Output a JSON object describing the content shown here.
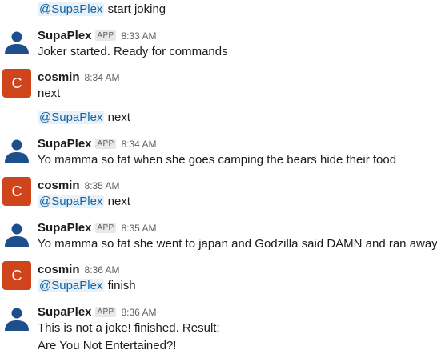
{
  "messages": [
    {
      "id": "m0",
      "continuation": true,
      "lines": [
        {
          "mention": "@SupaPlex",
          "text": " start joking"
        }
      ]
    },
    {
      "id": "m1",
      "author": "SupaPlex",
      "bot": true,
      "badge": "APP",
      "time": "8:33 AM",
      "lines": [
        {
          "text": "Joker started. Ready for commands"
        }
      ]
    },
    {
      "id": "m2",
      "author": "cosmin",
      "bot": false,
      "initial": "C",
      "time": "8:34 AM",
      "lines": [
        {
          "text": "next"
        }
      ]
    },
    {
      "id": "m3",
      "continuation": true,
      "lines": [
        {
          "mention": "@SupaPlex",
          "text": " next"
        }
      ]
    },
    {
      "id": "m4",
      "author": "SupaPlex",
      "bot": true,
      "badge": "APP",
      "time": "8:34 AM",
      "lines": [
        {
          "text": "Yo mamma so fat when she goes camping the bears hide their food"
        }
      ]
    },
    {
      "id": "m5",
      "author": "cosmin",
      "bot": false,
      "initial": "C",
      "time": "8:35 AM",
      "lines": [
        {
          "mention": "@SupaPlex",
          "text": " next"
        }
      ]
    },
    {
      "id": "m6",
      "author": "SupaPlex",
      "bot": true,
      "badge": "APP",
      "time": "8:35 AM",
      "lines": [
        {
          "text": "Yo mamma so fat she went to japan and Godzilla said DAMN and ran away."
        }
      ]
    },
    {
      "id": "m7",
      "author": "cosmin",
      "bot": false,
      "initial": "C",
      "time": "8:36 AM",
      "lines": [
        {
          "mention": "@SupaPlex",
          "text": " finish"
        }
      ]
    },
    {
      "id": "m8",
      "author": "SupaPlex",
      "bot": true,
      "badge": "APP",
      "time": "8:36 AM",
      "lines": [
        {
          "text": "This is not a joke! finished. Result:"
        },
        {
          "text": "Are You Not Entertained?!"
        }
      ]
    }
  ],
  "icons": {
    "bot_avatar": "person-silhouette-icon",
    "bot_avatar_color": "#1f4e8c",
    "user_avatar_color": "#d0441c"
  }
}
